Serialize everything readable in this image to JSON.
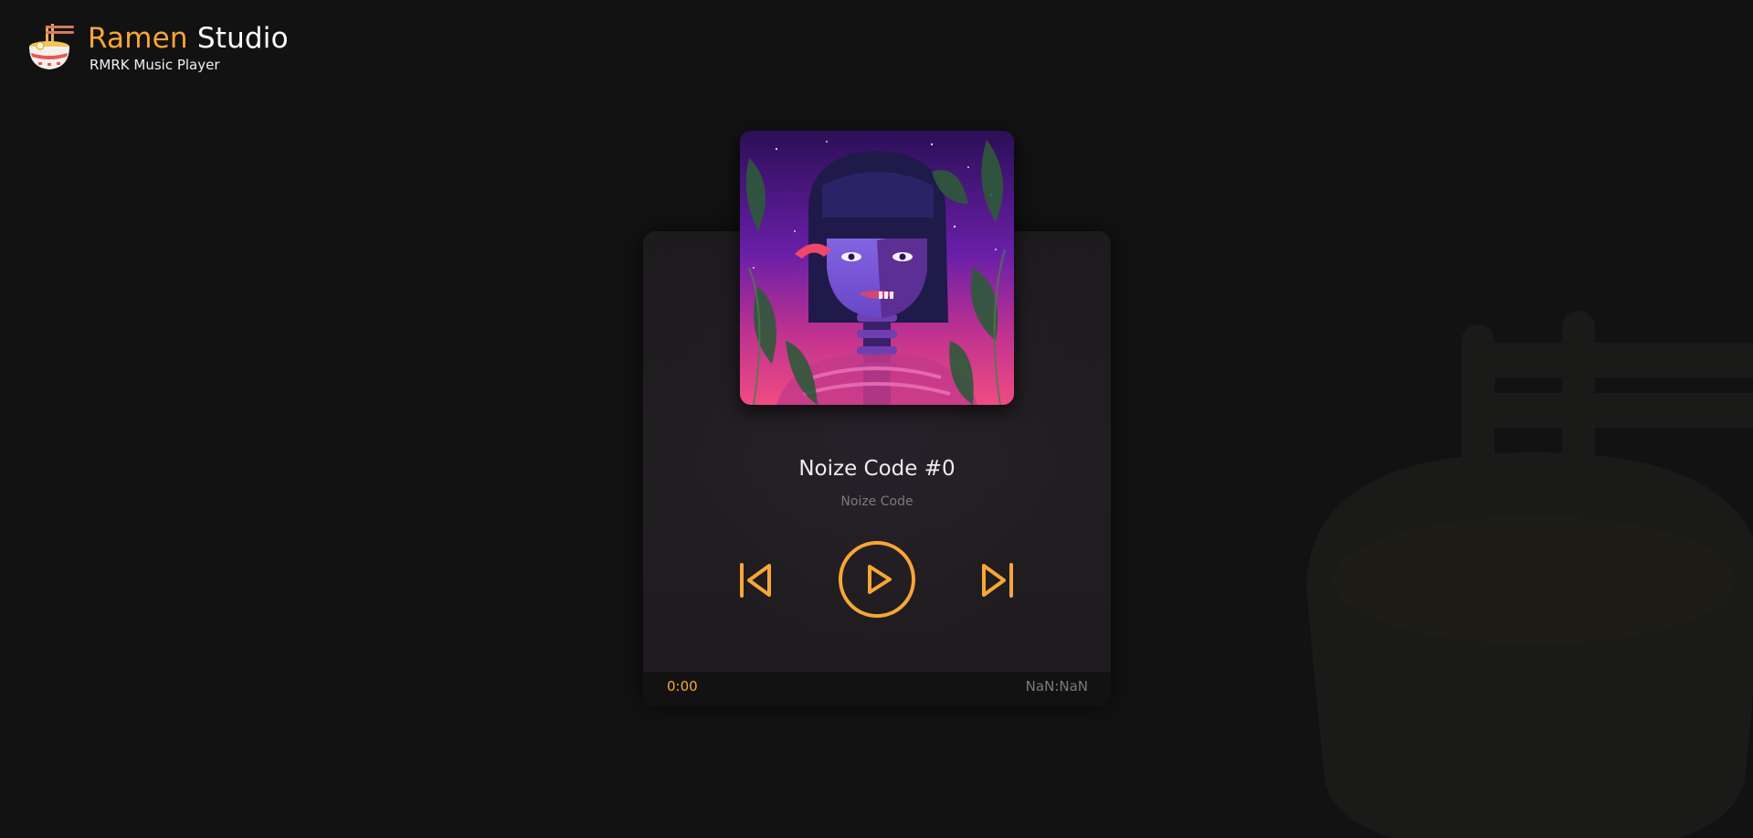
{
  "header": {
    "title_accent": "Ramen",
    "title_main": "Studio",
    "subtitle": "RMRK Music Player",
    "logo_icon": "ramen-bowl-icon"
  },
  "player": {
    "track_title": "Noize Code #0",
    "artist": "Noize Code",
    "album_art_icon": "album-art-illustration",
    "controls": {
      "previous_icon": "skip-previous-icon",
      "play_icon": "play-icon",
      "next_icon": "skip-next-icon"
    },
    "current_time": "0:00",
    "total_time": "NaN:NaN"
  },
  "colors": {
    "accent": "#f7a637",
    "background": "#121212",
    "card": "#1c1b1c",
    "muted_text": "#7a7a7a"
  }
}
